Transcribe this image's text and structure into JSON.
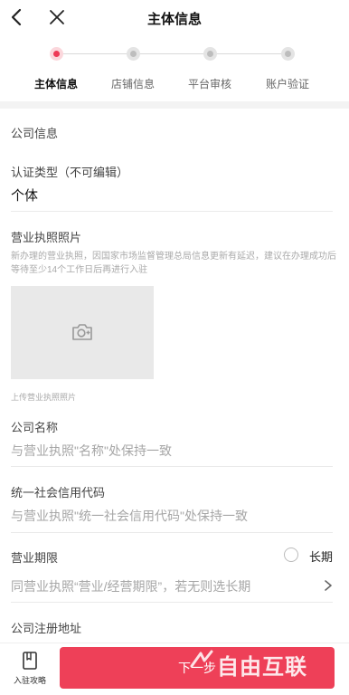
{
  "header": {
    "title": "主体信息"
  },
  "steps": [
    {
      "label": "主体信息",
      "active": true
    },
    {
      "label": "店铺信息",
      "active": false
    },
    {
      "label": "平台审核",
      "active": false
    },
    {
      "label": "账户验证",
      "active": false
    }
  ],
  "form": {
    "section_title": "公司信息",
    "cert_type": {
      "label": "认证类型（不可编辑）",
      "value": "个体"
    },
    "license_photo": {
      "label": "营业执照照片",
      "note": "新办理的营业执照，因国家市场监督管理总局信息更新有延迟，建议在办理成功后等待至少14个工作日后再进行入驻",
      "upload_caption": "上传营业执照照片"
    },
    "company_name": {
      "label": "公司名称",
      "placeholder": "与营业执照\"名称\"处保持一致"
    },
    "credit_code": {
      "label": "统一社会信用代码",
      "placeholder": "与营业执照\"统一社会信用代码\"处保持一致"
    },
    "business_term": {
      "label": "营业期限",
      "radio_label": "长期",
      "placeholder": "同营业执照“营业/经营期限”，若无则选长期"
    },
    "address": {
      "label": "公司注册地址"
    }
  },
  "bottom": {
    "guide_label": "入驻攻略",
    "next_label": "下一步",
    "watermark": "自由互联"
  },
  "colors": {
    "accent": "#ee4058",
    "step_active": "#ee3a57"
  }
}
